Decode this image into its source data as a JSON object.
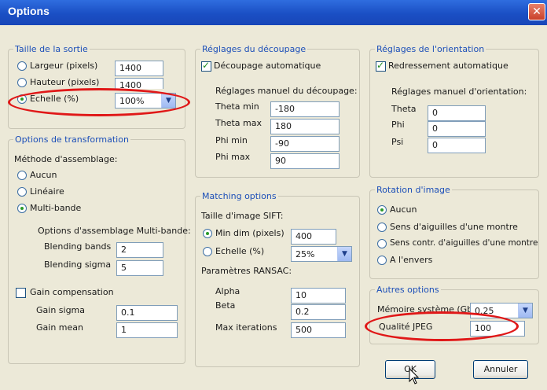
{
  "window": {
    "title": "Options",
    "close_glyph": "✕"
  },
  "output": {
    "legend": "Taille de la sortie",
    "width_label": "Largeur (pixels)",
    "width_value": "1400",
    "height_label": "Hauteur (pixels)",
    "height_value": "1400",
    "scale_label": "Echelle (%)",
    "scale_value": "100%",
    "selected": "scale"
  },
  "transform": {
    "legend": "Options de transformation",
    "method_label": "Méthode d'assemblage:",
    "method_none": "Aucun",
    "method_linear": "Linéaire",
    "method_multiband": "Multi-bande",
    "selected": "multiband",
    "multiband_options_label": "Options d'assemblage Multi-bande:",
    "blending_bands_label": "Blending bands",
    "blending_bands_value": "2",
    "blending_sigma_label": "Blending sigma",
    "blending_sigma_value": "5",
    "gain_comp_label": "Gain compensation",
    "gain_comp_checked": false,
    "gain_sigma_label": "Gain sigma",
    "gain_sigma_value": "0.1",
    "gain_mean_label": "Gain mean",
    "gain_mean_value": "1"
  },
  "cropping": {
    "legend": "Réglages du découpage",
    "auto_label": "Découpage automatique",
    "auto_checked": true,
    "manual_label": "Réglages manuel du découpage:",
    "theta_min_label": "Theta min",
    "theta_min_value": "-180",
    "theta_max_label": "Theta max",
    "theta_max_value": "180",
    "phi_min_label": "Phi min",
    "phi_min_value": "-90",
    "phi_max_label": "Phi max",
    "phi_max_value": "90"
  },
  "matching": {
    "legend": "Matching options",
    "sift_label": "Taille d'image SIFT:",
    "min_dim_label": "Min dim (pixels)",
    "min_dim_value": "400",
    "scale_label": "Echelle (%)",
    "scale_value": "25%",
    "selected": "min_dim",
    "ransac_label": "Paramètres RANSAC:",
    "alpha_label": "Alpha",
    "alpha_value": "10",
    "beta_label": "Beta",
    "beta_value": "0.2",
    "max_iter_label": "Max iterations",
    "max_iter_value": "500"
  },
  "orientation": {
    "legend": "Réglages de l'orientation",
    "auto_label": "Redressement automatique",
    "auto_checked": true,
    "manual_label": "Réglages manuel d'orientation:",
    "theta_label": "Theta",
    "theta_value": "0",
    "phi_label": "Phi",
    "phi_value": "0",
    "psi_label": "Psi",
    "psi_value": "0"
  },
  "rotation": {
    "legend": "Rotation d'image",
    "none_label": "Aucun",
    "cw_label": "Sens d'aiguilles d'une montre",
    "ccw_label": "Sens contr. d'aiguilles d'une montre",
    "flip_label": "A l'envers",
    "selected": "none"
  },
  "other": {
    "legend": "Autres options",
    "memory_label": "Mémoire système (Gb)",
    "memory_value": "0.25",
    "jpeg_label": "Qualité JPEG",
    "jpeg_value": "100"
  },
  "buttons": {
    "ok": "OK",
    "cancel": "Annuler"
  },
  "colors": {
    "highlight": "#e01818",
    "title_bar": "#1a4fc4"
  }
}
